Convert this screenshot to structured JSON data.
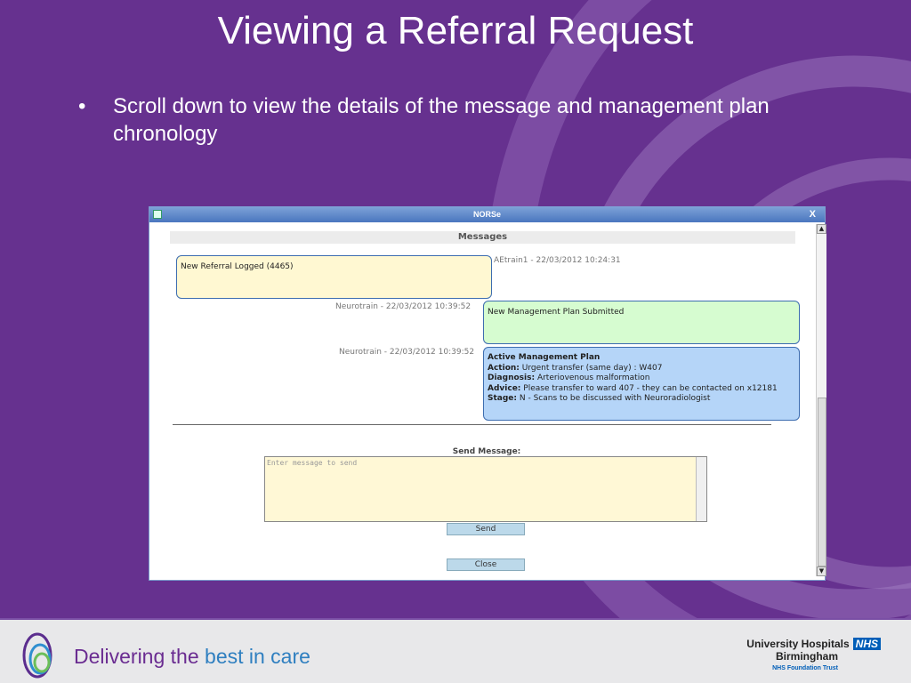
{
  "slide": {
    "title": "Viewing a Referral Request",
    "bullet": "Scroll down to view the details of the message and management plan chronology"
  },
  "window": {
    "title": "NORSe",
    "close": "X",
    "messages_header": "Messages",
    "messages": [
      {
        "text": "New Referral Logged (4465)",
        "meta": "AEtrain1 - 22/03/2012 10:24:31",
        "color": "#fff8d2"
      },
      {
        "text": "New Management Plan Submitted",
        "meta": "Neurotrain - 22/03/2012 10:39:52",
        "color": "#d6fcd0"
      },
      {
        "heading": "Active Management Plan",
        "action_label": "Action:",
        "action": "Urgent transfer (same day) : W407",
        "diagnosis_label": "Diagnosis:",
        "diagnosis": "Arteriovenous malformation",
        "advice_label": "Advice:",
        "advice": "Please transfer to ward 407 - they can be contacted on x12181",
        "stage_label": "Stage:",
        "stage": "N - Scans to be discussed with Neuroradiologist",
        "meta": "Neurotrain - 22/03/2012 10:39:52",
        "color": "#b5d5f8"
      }
    ],
    "send_label": "Send Message:",
    "placeholder": "Enter message to send",
    "send_button": "Send",
    "close_button": "Close"
  },
  "footer": {
    "tagline_a": "Delivering the",
    "tagline_b": "best in care",
    "org1": "University Hospitals",
    "nhs": "NHS",
    "org2": "Birmingham",
    "org3": "NHS Foundation Trust"
  }
}
